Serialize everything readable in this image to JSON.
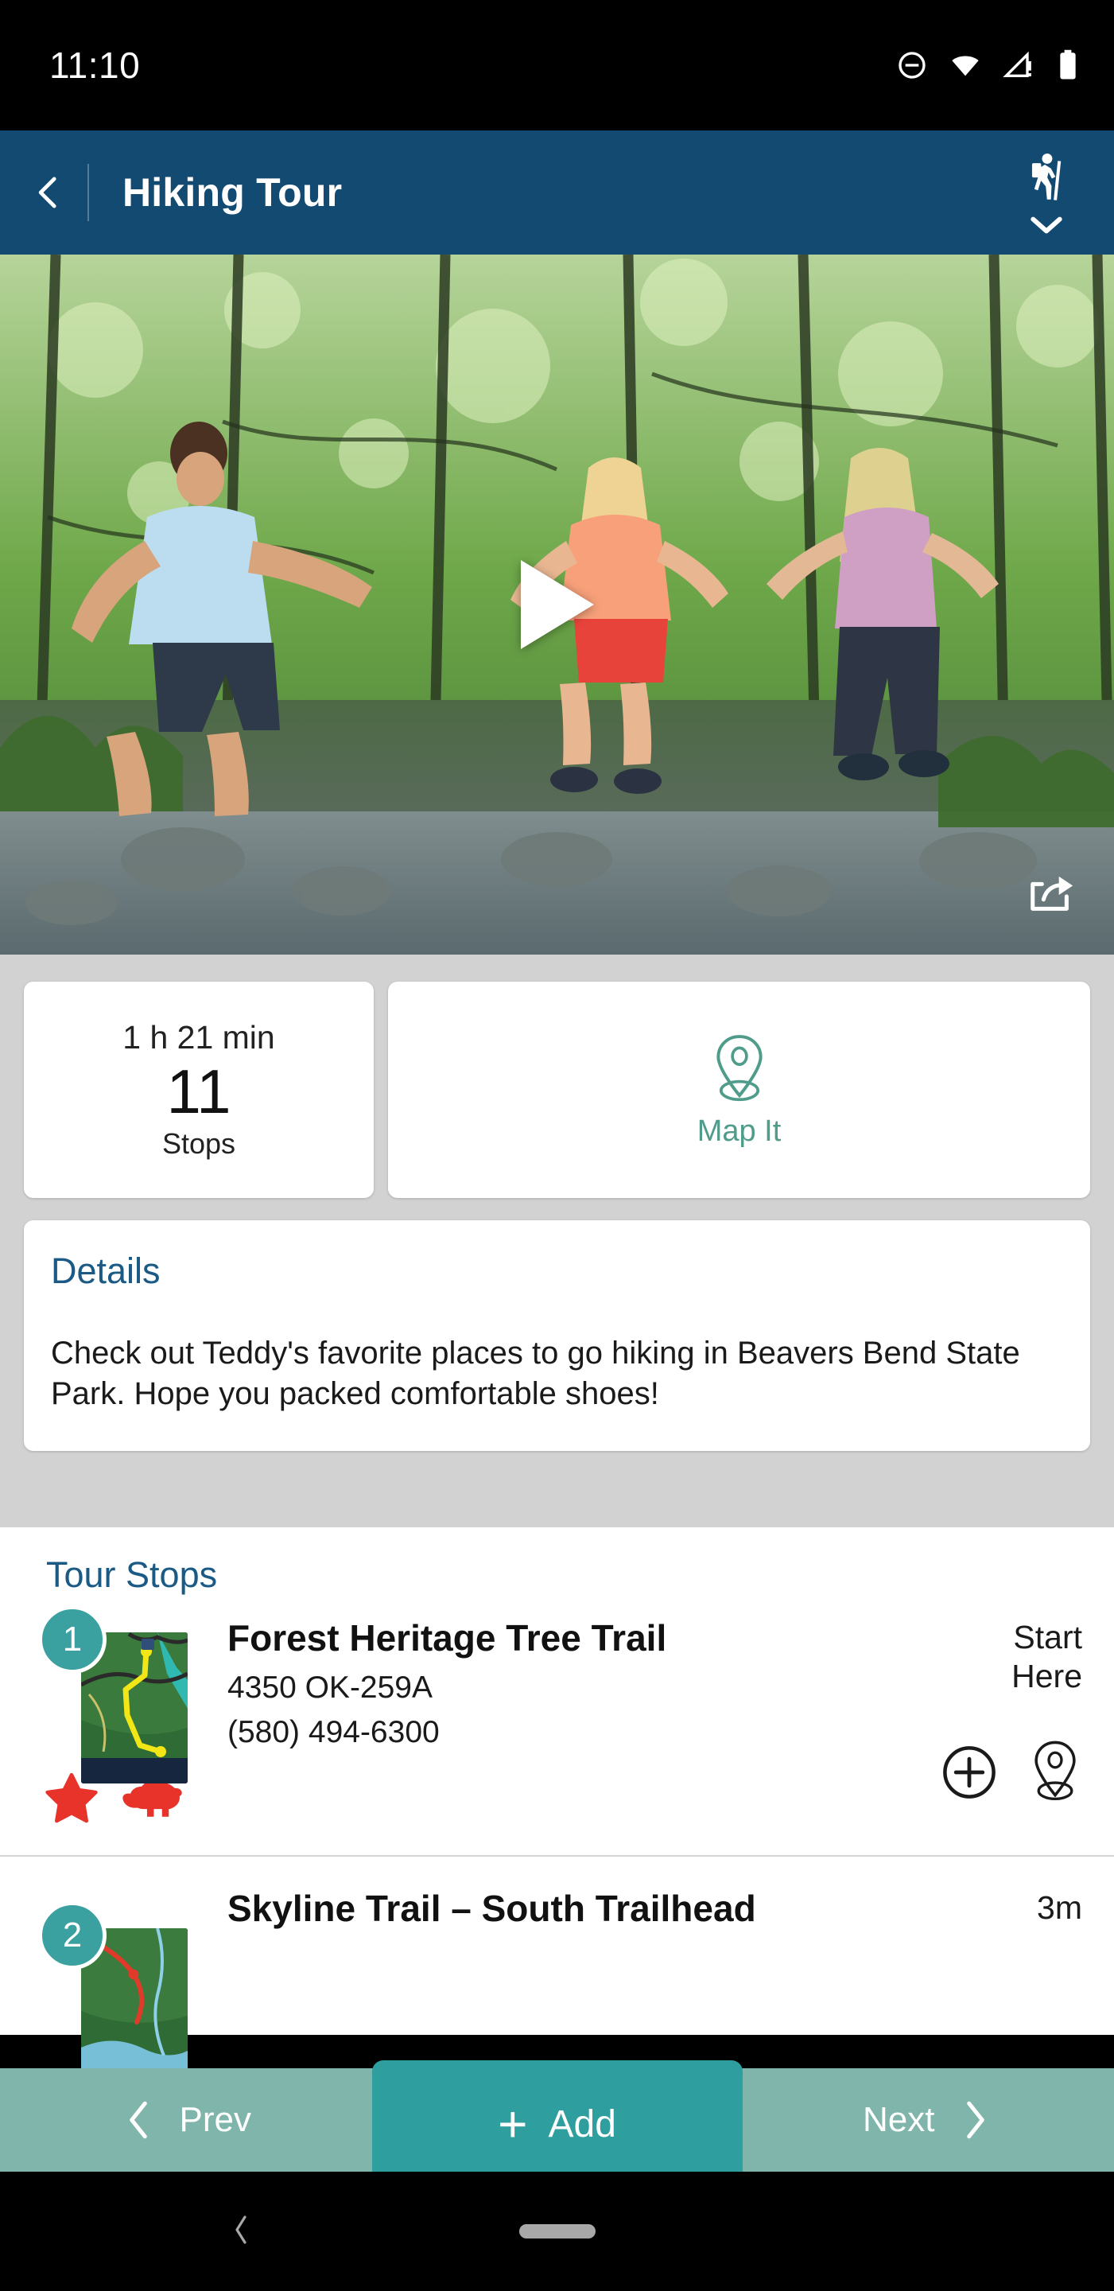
{
  "status_bar": {
    "time": "11:10",
    "icons": [
      "do-not-disturb-icon",
      "wifi-icon",
      "cell-signal-warning-icon",
      "battery-icon"
    ]
  },
  "header": {
    "title": "Hiking Tour",
    "back_icon": "chevron-left-icon",
    "mode_icon": "hiker-icon",
    "expand_icon": "chevron-down-icon"
  },
  "hero": {
    "play_icon": "play-icon",
    "share_icon": "share-icon"
  },
  "summary": {
    "duration": "1 h 21 min",
    "stop_count": "11",
    "stop_count_label": "Stops",
    "map_button_label": "Map It",
    "map_icon": "map-pin-icon"
  },
  "details": {
    "title": "Details",
    "text": "Check out Teddy's favorite places to go hiking in Beavers Bend State Park. Hope you packed comfortable shoes!"
  },
  "tour_stops": {
    "title": "Tour Stops",
    "items": [
      {
        "number": "1",
        "name": "Forest Heritage Tree Trail",
        "address": "4350 OK-259A",
        "phone": "(580) 494-6300",
        "eta_line1": "Start",
        "eta_line2": "Here",
        "tags": [
          "star-icon",
          "beaver-icon"
        ],
        "add_icon": "plus-circle-icon",
        "locate_icon": "map-pin-icon"
      },
      {
        "number": "2",
        "name": "Skyline Trail – South Trailhead",
        "eta_line1": "3m",
        "eta_line2": ""
      }
    ]
  },
  "bottom_nav": {
    "prev_label": "Prev",
    "prev_icon": "chevron-left-icon",
    "add_label": "Add",
    "add_icon": "plus-icon",
    "next_label": "Next",
    "next_icon": "chevron-right-icon"
  },
  "android_nav": {
    "back_icon": "chevron-left-icon",
    "home_pill": "home-pill"
  },
  "colors": {
    "header_blue": "#134a72",
    "teal_accent": "#2e9e9e",
    "teal_muted": "#80b5ab",
    "link_blue": "#1b5a84",
    "tag_red": "#e8332a",
    "map_green": "#4f9c8b",
    "page_bg": "#d2d2d2"
  }
}
